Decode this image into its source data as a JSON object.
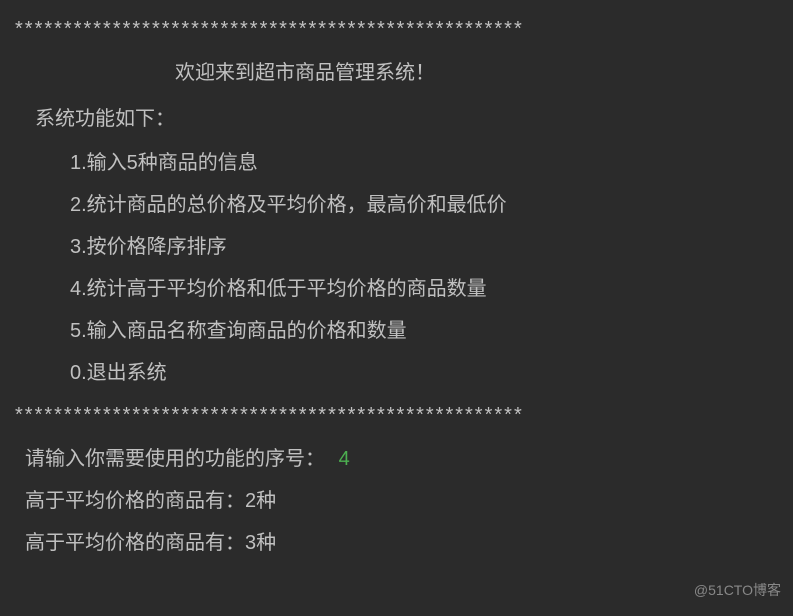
{
  "separator": "****************************************************",
  "title": "欢迎来到超市商品管理系统！",
  "subtitle": "系统功能如下：",
  "menu": {
    "items": [
      "1.输入5种商品的信息",
      "2.统计商品的总价格及平均价格，最高价和最低价",
      "3.按价格降序排序",
      "4.统计高于平均价格和低于平均价格的商品数量",
      "5.输入商品名称查询商品的价格和数量",
      "0.退出系统"
    ]
  },
  "prompt": "请输入你需要使用的功能的序号：",
  "user_input": "4",
  "results": [
    "高于平均价格的商品有：2种",
    "高于平均价格的商品有：3种"
  ],
  "watermark": "@51CTO博客"
}
